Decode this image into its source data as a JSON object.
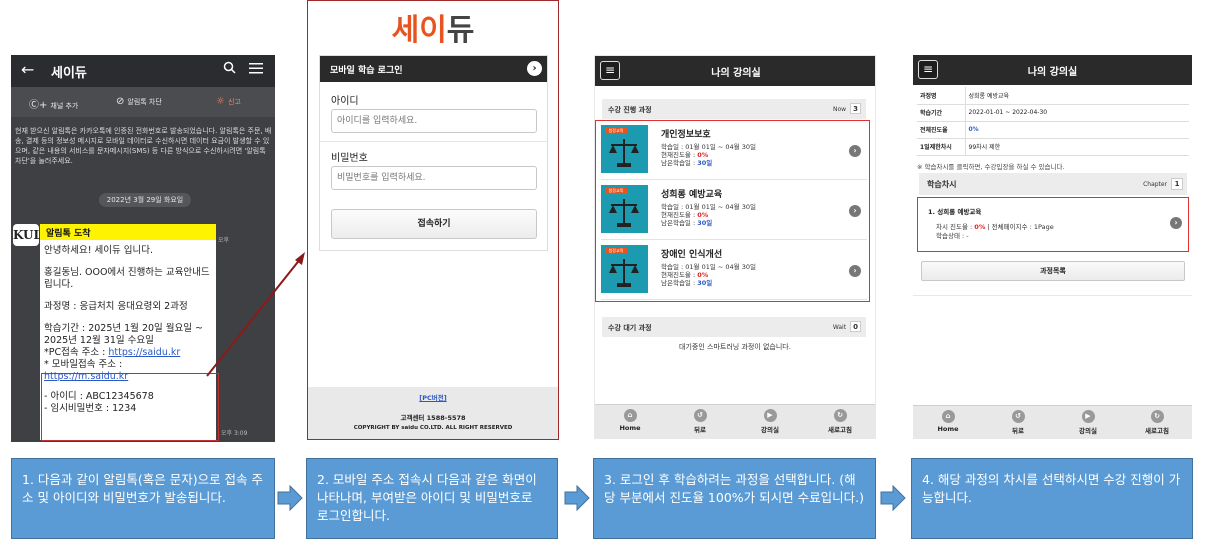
{
  "kakao": {
    "title": "세이듀",
    "back_icon": "←",
    "actions": [
      "채널 추가",
      "알림톡 차단",
      "신고"
    ],
    "notice": "현재 받으신 알림톡은 카카오톡에 인증된 전화번호로 발송되었습니다. 알림톡은 주문, 배송, 결제 등의 정보성 메시지로 모바일 데이터로 수신하시면 데이터 요금이 발생할 수 있으며, 같은 내용의 서비스를 문자메시지(SMS) 등 다른 방식으로 수신하시려면 '알림톡 차단'을 눌러주세요.",
    "date": "2022년 3월 29일 화요일",
    "logo": "KUL",
    "bubble_header": "알림톡 도착",
    "greeting": "안녕하세요! 세이듀 입니다.",
    "intro": "홍길동님. OOO에서 진행하는 교육안내드립니다.",
    "course": "과정명 : 응급처치 응대요령외 2과정",
    "period": "학습기간 : 2025년 1월 20일 월요일 ~ 2025년 12월 31일 수요일",
    "pc_label": "*PC접속 주소 : ",
    "pc_url": "https://saidu.kr",
    "mobile_label": "* 모바일접속 주소 :",
    "mobile_url": "https://m.saidu.kr",
    "id_line": "-   아이디 : ABC12345678",
    "pw_line": "-   임시비밀번호 : 1234",
    "time1": "오후",
    "time2": "오후 3:09"
  },
  "login": {
    "brand_1": "세",
    "brand_2": "이",
    "brand_3": "듀",
    "header": "모바일 학습 로그인",
    "id_label": "아이디",
    "id_placeholder": "아이디를 입력하세요.",
    "pw_label": "비밀번호",
    "pw_placeholder": "비밀번호를 입력하세요.",
    "submit": "접속하기",
    "pc_link": "[PC버전]",
    "cs": "고객센터 1588-5578",
    "copyright": "COPYRIGHT BY saidu CO.LTD. ALL RIGHT RESERVED"
  },
  "classroom": {
    "title": "나의 강의실",
    "in_progress_label": "수강 진행 과정",
    "in_progress_count_label": "Now",
    "in_progress_count": "3",
    "courses": [
      {
        "tag": "법정교육",
        "title": "개인정보보호",
        "period": "학습일 : 01월 01일 ~ 04월 30일",
        "progress_label": "현재진도율 : ",
        "progress": "0%",
        "remain_label": "남은학습일 : ",
        "remain": "30일"
      },
      {
        "tag": "법정교육",
        "title": "성희롱 예방교육",
        "period": "학습일 : 01월 01일 ~ 04월 30일",
        "progress_label": "현재진도율 : ",
        "progress": "0%",
        "remain_label": "남은학습일 : ",
        "remain": "30일"
      },
      {
        "tag": "법정교육",
        "title": "장애인 인식개선",
        "period": "학습일 : 01월 01일 ~ 04월 30일",
        "progress_label": "현재진도율 : ",
        "progress": "0%",
        "remain_label": "남은학습일 : ",
        "remain": "30일"
      }
    ],
    "waiting_label": "수강 대기 과정",
    "waiting_count_label": "Wait",
    "waiting_count": "0",
    "waiting_empty": "대기중인 스마트러닝 과정이 없습니다."
  },
  "detail": {
    "title": "나의 강의실",
    "rows": [
      {
        "k": "과정명",
        "v": "성희롱 예방교육"
      },
      {
        "k": "학습기간",
        "v": "2022-01-01 ~ 2022-04-30"
      },
      {
        "k": "전체진도율",
        "v": "0%"
      },
      {
        "k": "1일제한차시",
        "v": "99차시 제한"
      }
    ],
    "note": "※ 학습차시를 클릭하면, 수강입장을 하실 수 있습니다.",
    "chapter_label": "학습차시",
    "chapter_count_label": "Chapter",
    "chapter_count": "1",
    "chapter_title": "1. 성희롱 예방교육",
    "chapter_progress_label": "차시 진도율 : ",
    "chapter_progress": "0%",
    "chapter_pages": " | 전체페이지수 : 1Page",
    "chapter_status": "학습상태 : -",
    "list_button": "과정목록"
  },
  "nav": [
    "Home",
    "뒤로",
    "강의실",
    "새로고침"
  ],
  "steps": [
    "1. 다음과 같이 알림톡(혹은 문자)으로 접속 주소 및 아이디와 비밀번호가 발송됩니다.",
    "2. 모바일 주소 접속시 다음과 같은 화면이 나타나며, 부여받은 아이디 및 비밀번호로 로그인합니다.",
    "3. 로그인 후 학습하려는 과정을 선택합니다. (해당 부분에서 진도율 100%가 되시면 수료입니다.)",
    "4. 해당 과정의 차시를 선택하시면 수강 진행이 가능합니다."
  ],
  "colors": {
    "accent_red": "#e03030",
    "step_blue": "#5b9bd5",
    "brand_orange": "#e85420"
  }
}
